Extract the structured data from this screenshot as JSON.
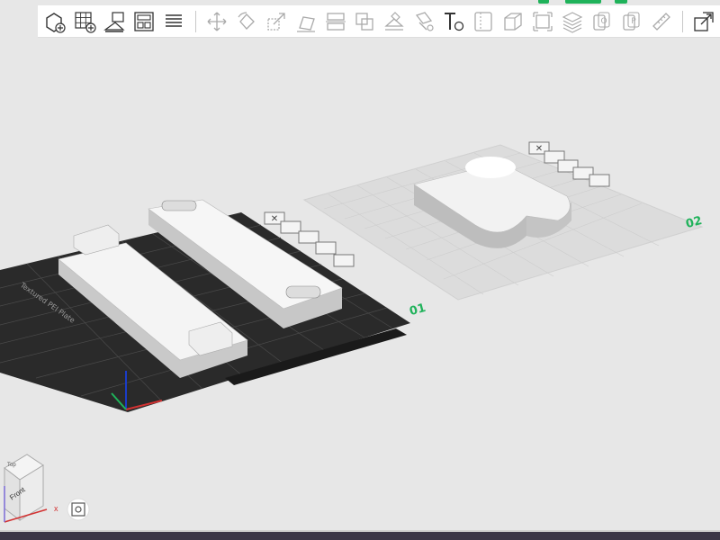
{
  "toolbar": {
    "tools": [
      {
        "icon": "add-object-icon"
      },
      {
        "icon": "add-plate-icon"
      },
      {
        "icon": "auto-orient-icon"
      },
      {
        "icon": "arrange-icon"
      },
      {
        "icon": "layers-split-icon"
      },
      {
        "icon": "move-icon"
      },
      {
        "icon": "rotate-icon"
      },
      {
        "icon": "scale-icon"
      },
      {
        "icon": "lay-on-face-icon"
      },
      {
        "icon": "cut-icon"
      },
      {
        "icon": "boolean-icon"
      },
      {
        "icon": "support-paint-icon"
      },
      {
        "icon": "color-paint-icon"
      },
      {
        "icon": "text-icon",
        "glyph": "Ta"
      },
      {
        "icon": "seam-icon"
      },
      {
        "icon": "assembly-icon"
      },
      {
        "icon": "measure-frame-icon"
      },
      {
        "icon": "variable-layer-icon"
      },
      {
        "icon": "split-objects-icon"
      },
      {
        "icon": "split-parts-icon"
      },
      {
        "icon": "ruler-icon"
      },
      {
        "icon": "assembly-view-icon"
      }
    ]
  },
  "plates": [
    {
      "label": "01",
      "bed_text": "Textured PEI Plate"
    },
    {
      "label": "02"
    }
  ],
  "view_cube": {
    "face_label": "Front",
    "top_label": "Top",
    "axis_x": "x"
  },
  "colors": {
    "accent": "#1fb25a",
    "bed": "#2a2a2a",
    "background": "#e7e7e7"
  }
}
